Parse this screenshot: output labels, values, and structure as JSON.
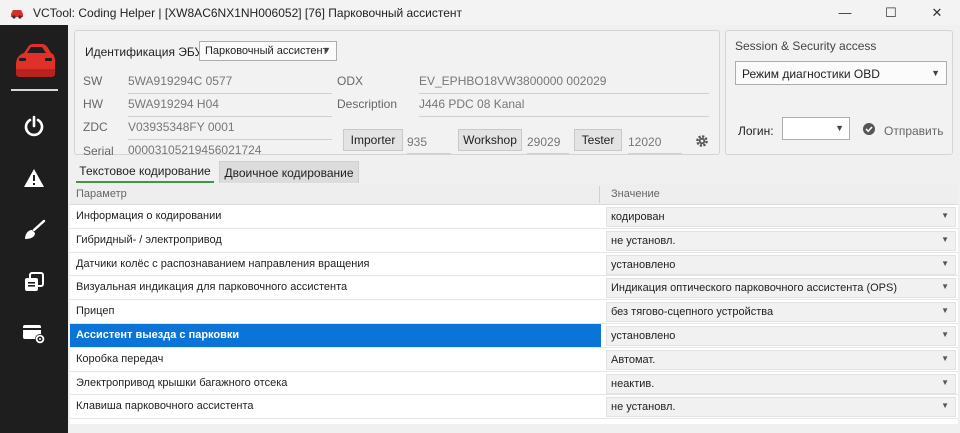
{
  "window": {
    "title": "VCTool: Coding Helper | [XW8AC6NX1NH006052] [76] Парковочный ассистент",
    "minimize": "—",
    "maximize": "☐",
    "close": "✕"
  },
  "sidebar": {
    "icons": [
      "car-logo-icon",
      "power-icon",
      "warning-icon",
      "brush-icon",
      "copy-icon",
      "settings-card-icon"
    ]
  },
  "ecu": {
    "label": "Идентификация ЭБУ",
    "selected": "Парковочный ассистент",
    "fields": {
      "sw_label": "SW",
      "sw_value": "5WA919294C 0577",
      "hw_label": "HW",
      "hw_value": "5WA919294 H04",
      "zdc_label": "ZDC",
      "zdc_value": "V03935348FY 0001",
      "serial_label": "Serial",
      "serial_value": "00003105219456021724",
      "odx_label": "ODX",
      "odx_value": "EV_EPHBO18VW3800000 002029",
      "desc_label": "Description",
      "desc_value": "J446 PDC 08 Kanal"
    },
    "importer_label": "Importer",
    "importer_value": "935",
    "workshop_label": "Workshop",
    "workshop_value": "29029",
    "tester_label": "Tester",
    "tester_value": "12020"
  },
  "session": {
    "title": "Session & Security access",
    "mode": "Режим диагностики OBD",
    "login_label": "Логин:",
    "login_value": "",
    "send_label": "Отправить"
  },
  "tabs": [
    {
      "label": "Текстовое кодирование",
      "active": true
    },
    {
      "label": "Двоичное кодирование",
      "active": false
    }
  ],
  "table": {
    "col_param": "Параметр",
    "col_value": "Значение",
    "rows": [
      {
        "param": "Информация о кодировании",
        "value": "кодирован"
      },
      {
        "param": "Гибридный- / электропривод",
        "value": "не установл."
      },
      {
        "param": "Датчики колёс с распознаванием направления вращения",
        "value": "установлено"
      },
      {
        "param": "Визуальная индикация для парковочного ассистента",
        "value": "Индикация оптического парковочного ассистента (OPS)"
      },
      {
        "param": "Прицеп",
        "value": "без тягово-сцепного устройства"
      },
      {
        "param": "Ассистент выезда с парковки",
        "value": "установлено",
        "selected": true
      },
      {
        "param": "Коробка передач",
        "value": "Автомат."
      },
      {
        "param": "Электропривод крышки багажного отсека",
        "value": "неактив."
      },
      {
        "param": "Клавиша парковочного ассистента",
        "value": "не установл."
      }
    ]
  },
  "colors": {
    "sidebar_bg": "#1e1e1e",
    "accent_red": "#e0302a",
    "selection_blue": "#0a74d9",
    "tab_underline": "#3c9a3c"
  }
}
